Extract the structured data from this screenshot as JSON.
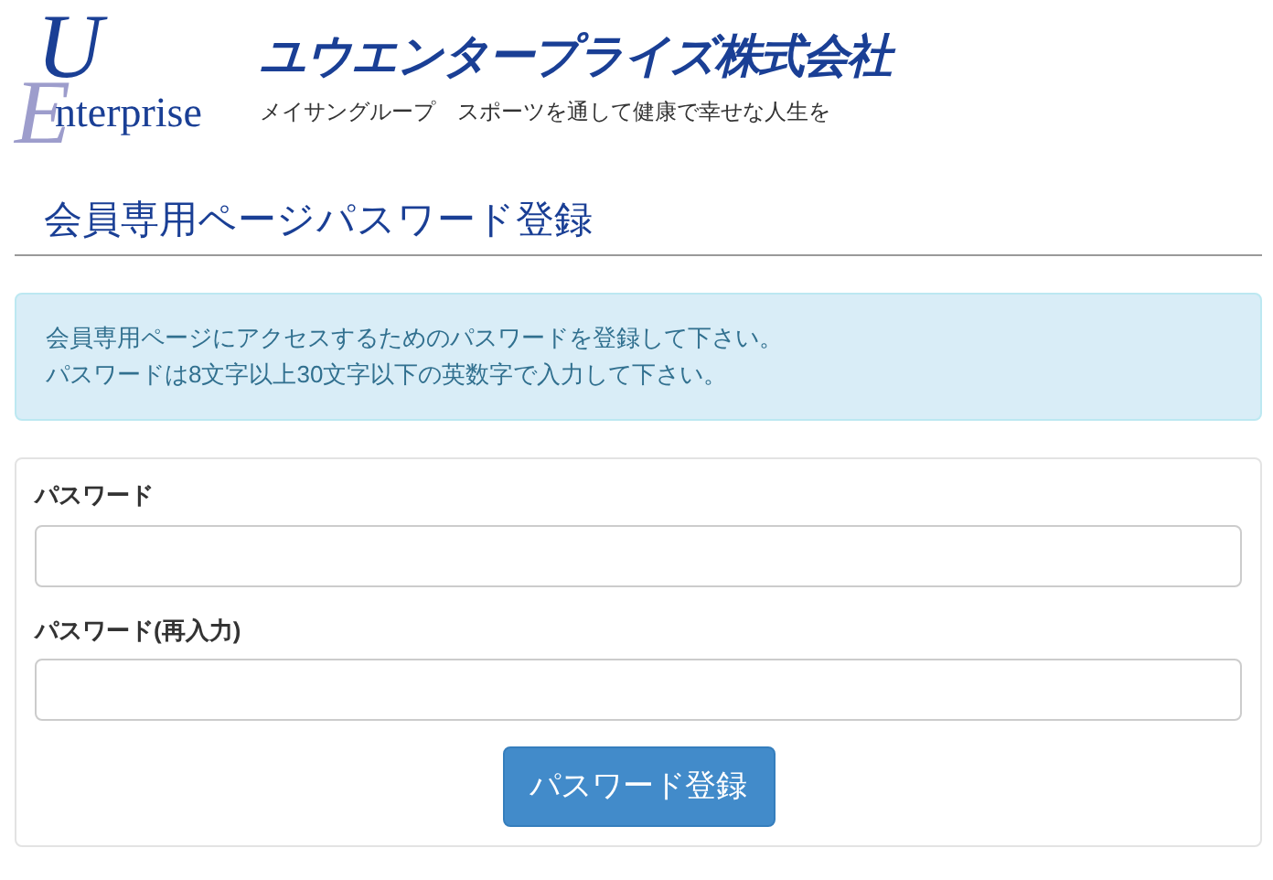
{
  "logo": {
    "big_top": "U",
    "big_bottom": "E",
    "rest": "nterprise"
  },
  "company": {
    "name": "ユウエンタープライズ株式会社",
    "tagline": "メイサングループ　スポーツを通して健康で幸せな人生を"
  },
  "page_title": "会員専用ページパスワード登録",
  "notice": [
    "会員専用ページにアクセスするためのパスワードを登録して下さい。",
    "パスワードは8文字以上30文字以下の英数字で入力して下さい。"
  ],
  "form": {
    "fields": [
      {
        "label": "パスワード"
      },
      {
        "label": "パスワード(再入力)"
      }
    ],
    "submit": "パスワード登録"
  }
}
